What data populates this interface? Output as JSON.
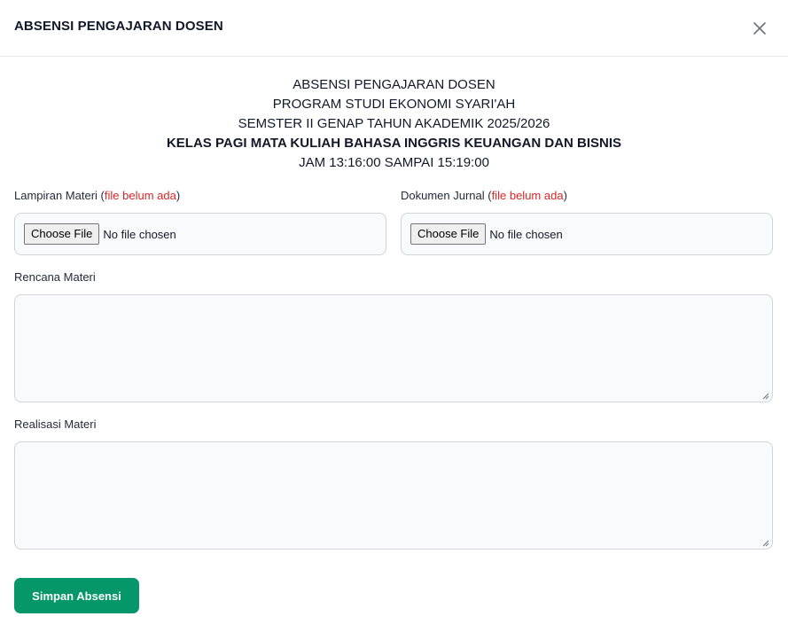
{
  "modal": {
    "title": "ABSENSI PENGAJARAN DOSEN",
    "close_icon": "close-icon"
  },
  "heading": {
    "line1": "ABSENSI PENGAJARAN DOSEN",
    "line2": "PROGRAM STUDI EKONOMI SYARI'AH",
    "line3": "SEMSTER II GENAP TAHUN AKADEMIK 2025/2026",
    "line4": "KELAS PAGI MATA KULIAH BAHASA INGGRIS KEUANGAN DAN BISNIS",
    "line5": "JAM 13:16:00 SAMPAI 15:19:00"
  },
  "lampiran": {
    "label": "Lampiran Materi",
    "status": "file belum ada",
    "button": "Choose File",
    "file_text": "No file chosen"
  },
  "jurnal": {
    "label": "Dokumen Jurnal",
    "status": "file belum ada",
    "button": "Choose File",
    "file_text": "No file chosen"
  },
  "rencana": {
    "label": "Rencana Materi",
    "value": ""
  },
  "realisasi": {
    "label": "Realisasi Materi",
    "value": ""
  },
  "submit": {
    "label": "Simpan Absensi"
  },
  "colors": {
    "primary": "#059669",
    "warning": "#dc2626"
  }
}
